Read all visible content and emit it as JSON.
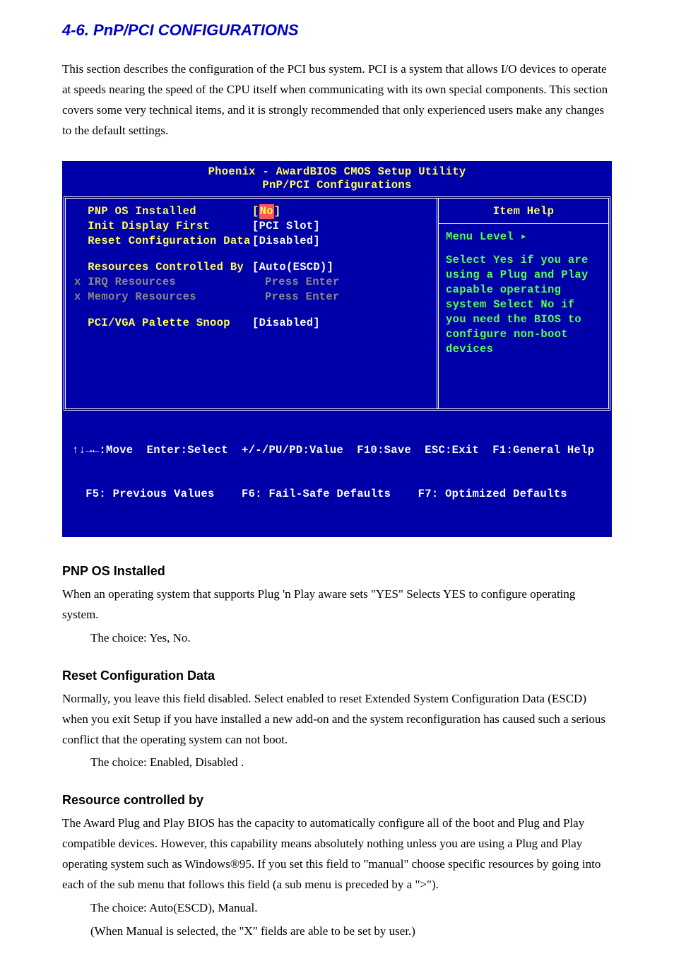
{
  "page_title": "4-6. PnP/PCI CONFIGURATIONS",
  "intro": "This section describes the configuration of the PCI bus system. PCI is a system that allows I/O devices to operate at speeds nearing the speed of the CPU itself when communicating with its own special components. This section covers some very technical items, and it is strongly recommended that only experienced users make any changes to the default settings.",
  "bios": {
    "title_line1": "Phoenix - AwardBIOS CMOS Setup Utility",
    "title_line2": "PnP/PCI Configurations",
    "rows": {
      "pnp": {
        "label": "  PNP OS Installed",
        "value": "[",
        "value_sel": "No",
        "value_after": "]"
      },
      "init": {
        "label": "  Init Display First",
        "value": "[PCI Slot]"
      },
      "reset": {
        "label": "  Reset Configuration Data",
        "value": "[Disabled]"
      },
      "res": {
        "label": "  Resources Controlled By",
        "value": "[Auto(ESCD)]"
      },
      "irq": {
        "label": "x IRQ Resources",
        "value": "Press Enter"
      },
      "mem": {
        "label": "x Memory Resources",
        "value": "Press Enter"
      },
      "pci": {
        "label": "  PCI/VGA Palette Snoop",
        "value": "[Disabled]"
      }
    },
    "help": {
      "title": "Item Help",
      "menu": "Menu Level   ▸",
      "body": "Select Yes if you are using a Plug and Play capable operating system Select No if you need the BIOS to configure non-boot devices"
    },
    "footer1": "↑↓→←:Move  Enter:Select  +/-/PU/PD:Value  F10:Save  ESC:Exit  F1:General Help",
    "footer2": "  F5: Previous Values    F6: Fail-Safe Defaults    F7: Optimized Defaults"
  },
  "sections": {
    "pnp_h": "PNP OS Installed",
    "pnp_p": "When an operating system that supports Plug 'n Play aware sets \"YES\" Selects YES to configure operating system.",
    "pnp_c": "The choice: Yes, No.",
    "reset_h": "Reset Configuration Data",
    "reset_p1": "Normally, you leave this field disabled. Select enabled to reset Extended System Configuration Data (ESCD) when you exit Setup if you have installed a new add-on and the system reconfiguration has caused such a serious conflict that the operating system can not boot.",
    "reset_c": "The choice: Enabled, Disabled .",
    "rcb_h": "Resource controlled by",
    "rcb_p": "The Award Plug and Play BIOS has the capacity to automatically configure all of the boot and Plug and Play compatible devices. However, this capability means absolutely nothing unless you are using a Plug and Play operating system such as Windows®95. If you set this field to \"manual\" choose specific resources by going into each of the sub menu that follows this field (a sub menu is preceded by a \">\").",
    "rcb_c1": "The choice: Auto(ESCD), Manual.",
    "rcb_c2": "(When Manual is selected, the \"X\" fields are able to be set by user.)"
  },
  "registered": "®"
}
